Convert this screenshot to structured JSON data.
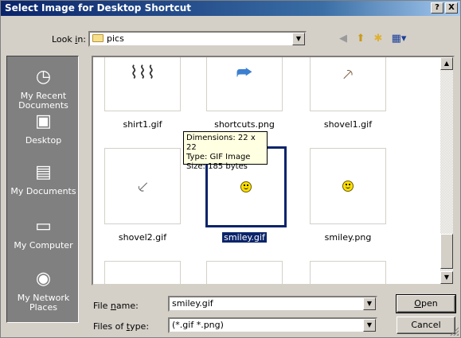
{
  "window": {
    "title": "Select Image for Desktop Shortcut",
    "help_label": "?",
    "close_label": "X"
  },
  "lookin": {
    "label_prefix": "Look ",
    "label_key": "i",
    "label_suffix": "n:",
    "value": "pics",
    "icon": "folder-icon"
  },
  "toolbar": {
    "icons": [
      "back-icon",
      "up-folder-icon",
      "new-folder-icon",
      "view-menu-icon"
    ]
  },
  "places": [
    {
      "label": "My Recent Documents",
      "icon": "recent-documents-icon"
    },
    {
      "label": "Desktop",
      "icon": "desktop-icon"
    },
    {
      "label": "My Documents",
      "icon": "my-documents-icon"
    },
    {
      "label": "My Computer",
      "icon": "my-computer-icon"
    },
    {
      "label": "My Network Places",
      "icon": "network-places-icon"
    }
  ],
  "files": [
    {
      "name": "shirt1.gif",
      "icon": "shirt-icon"
    },
    {
      "name": "shortcuts.png",
      "icon": "shortcut-arrow-icon"
    },
    {
      "name": "shovel1.gif",
      "icon": "shovel-icon"
    },
    {
      "name": "shovel2.gif",
      "icon": "shovel-icon"
    },
    {
      "name": "smiley.gif",
      "icon": "smiley-icon",
      "selected": true
    },
    {
      "name": "smiley.png",
      "icon": "smiley-icon"
    }
  ],
  "tooltip": {
    "dimensions": "Dimensions: 22 x 22",
    "type": "Type: GIF Image",
    "size": "Size: 185 bytes"
  },
  "filename": {
    "label_prefix": "File ",
    "label_key": "n",
    "label_suffix": "ame:",
    "value": "smiley.gif"
  },
  "filetype": {
    "label_prefix": "Files of ",
    "label_key": "t",
    "label_suffix": "ype:",
    "value": "(*.gif *.png)"
  },
  "buttons": {
    "open_key": "O",
    "open_rest": "pen",
    "cancel": "Cancel"
  },
  "colors": {
    "title_bar": "#0a246a",
    "selection": "#0a246a",
    "tooltip_bg": "#ffffe1",
    "places_bg": "#808080"
  }
}
